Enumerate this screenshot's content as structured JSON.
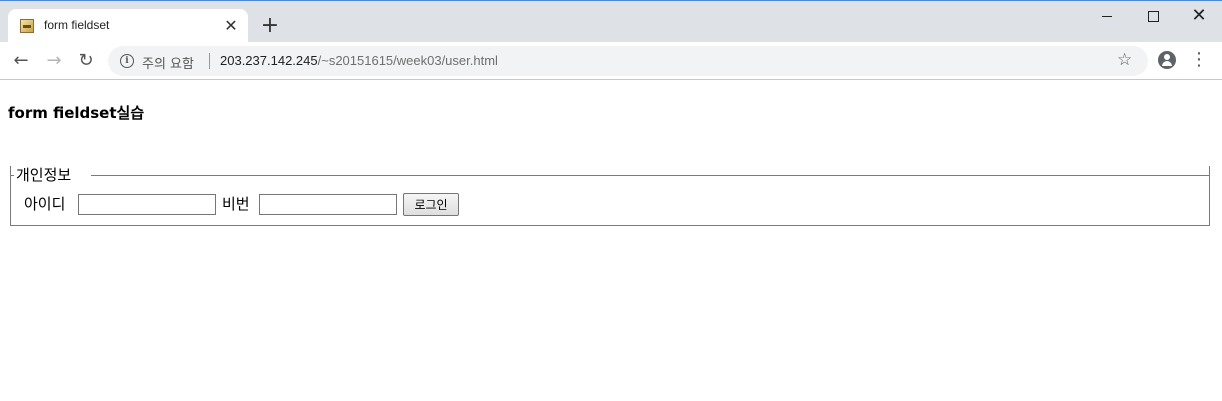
{
  "browser": {
    "tab_title": "form fieldset",
    "tab_close": "✕",
    "new_tab": "+",
    "window": {
      "close": "✕"
    },
    "toolbar": {
      "back": "←",
      "forward": "→",
      "reload": "↻",
      "security_label": "주의 요함",
      "url_host": "203.237.142.245",
      "url_path": "/~s20151615/week03/user.html",
      "star": "☆",
      "menu": "⋮"
    },
    "icons": [
      "favicon-icon",
      "close-icon",
      "plus-icon",
      "back-arrow-icon",
      "forward-arrow-icon",
      "reload-icon",
      "info-icon",
      "star-icon",
      "account-icon",
      "menu-dots-icon"
    ]
  },
  "page": {
    "heading": "form fieldset실습",
    "fieldset": {
      "legend": "개인정보",
      "id_label": "아이디",
      "id_value": "",
      "pw_label": "비번",
      "pw_value": "",
      "login_button": "로그인"
    }
  }
}
